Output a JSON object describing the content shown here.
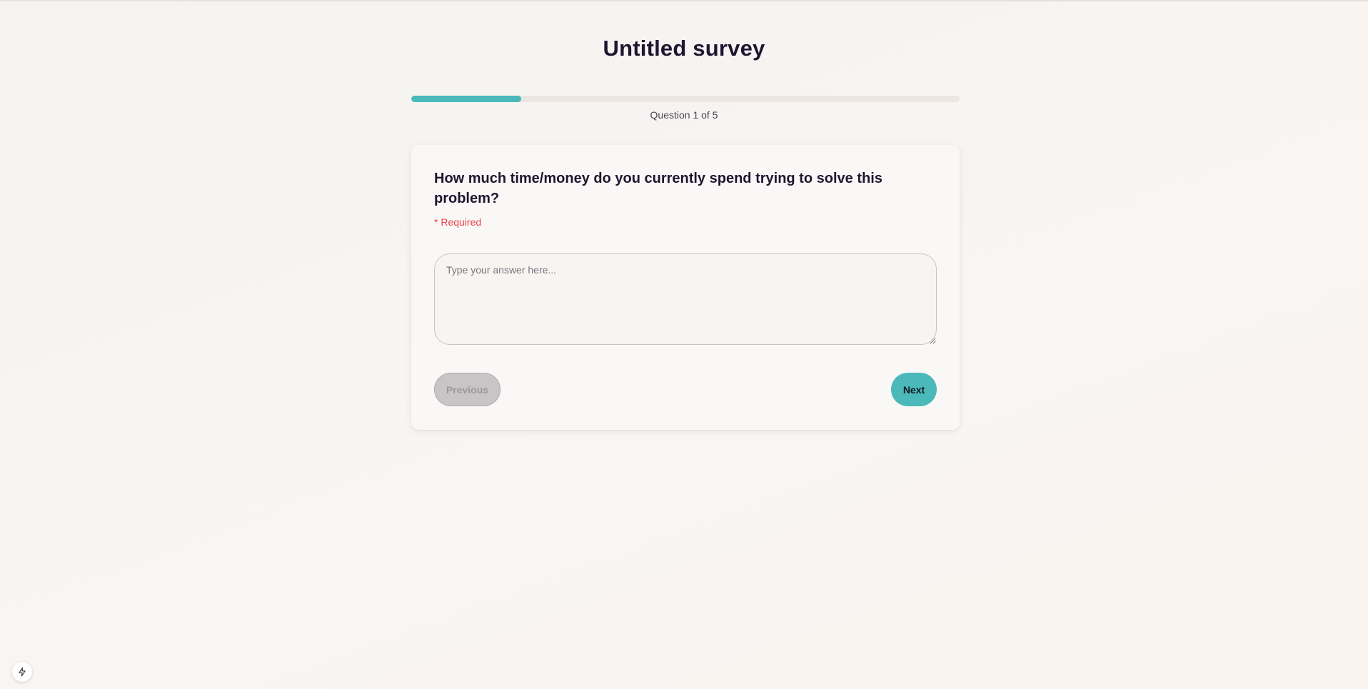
{
  "survey": {
    "title": "Untitled survey",
    "progress_text": "Question 1 of 5",
    "progress_fraction": 0.2,
    "accent_color": "#4bb8b9"
  },
  "question": {
    "text": "How much time/money do you currently spend trying to solve this problem?",
    "required_label": "* Required",
    "required_color": "#e8424f",
    "answer_placeholder": "Type your answer here...",
    "answer_value": ""
  },
  "navigation": {
    "previous_label": "Previous",
    "next_label": "Next"
  },
  "corner_badge": {
    "icon": "lightning-bolt-icon"
  }
}
